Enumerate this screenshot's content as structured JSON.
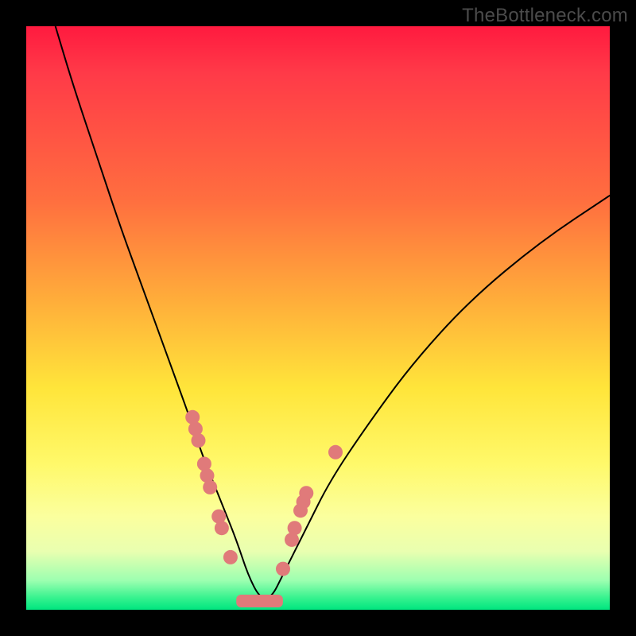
{
  "watermark": "TheBottleneck.com",
  "colors": {
    "frame": "#000000",
    "gradient_top": "#ff1a3f",
    "gradient_mid1": "#ff6f3f",
    "gradient_mid2": "#ffe53a",
    "gradient_bottom": "#00e57f",
    "curve": "#000000",
    "markers": "#e07a7a"
  },
  "chart_data": {
    "type": "line",
    "title": "",
    "xlabel": "",
    "ylabel": "",
    "xlim": [
      0,
      100
    ],
    "ylim": [
      0,
      100
    ],
    "curve": {
      "description": "V-shaped bottleneck curve; minimum near x≈40, rising steeply to both sides",
      "x": [
        5,
        8,
        12,
        16,
        20,
        24,
        28,
        30,
        32,
        34,
        36,
        38,
        40,
        42,
        44,
        48,
        52,
        58,
        66,
        76,
        88,
        100
      ],
      "y": [
        100,
        90,
        78,
        66,
        55,
        44,
        33,
        27,
        22,
        17,
        12,
        6,
        2,
        2,
        6,
        14,
        22,
        31,
        42,
        53,
        63,
        71
      ]
    },
    "markers_left": {
      "x": [
        28.5,
        29,
        29.5,
        30.5,
        31,
        31.5,
        33,
        33.5,
        35
      ],
      "y": [
        33,
        31,
        29,
        25,
        23,
        21,
        16,
        14,
        9
      ]
    },
    "markers_right": {
      "x": [
        44,
        45.5,
        46,
        47,
        47.5,
        48,
        53
      ],
      "y": [
        7,
        12,
        14,
        17,
        18.5,
        20,
        27
      ]
    },
    "valley_band": {
      "x_start": 36,
      "x_end": 44,
      "y": 1.5
    }
  }
}
